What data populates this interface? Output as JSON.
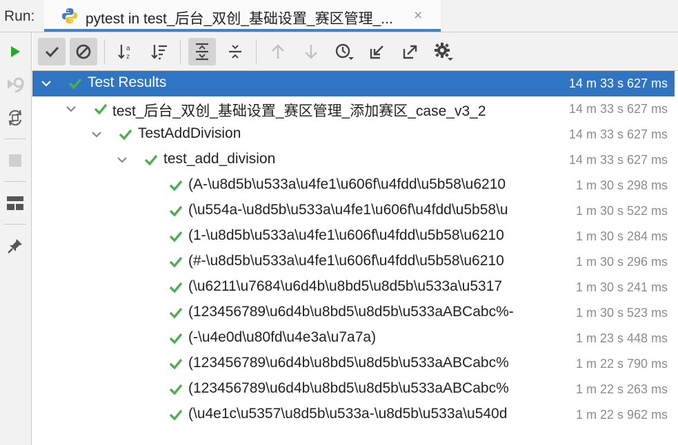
{
  "run_bar": {
    "label": "Run:",
    "tab_title": "pytest in test_后台_双创_基础设置_赛区管理_...",
    "close_glyph": "×"
  },
  "colors": {
    "accent": "#2f75c4",
    "pass_green": "#4caf50",
    "run_green": "#2aa52a"
  },
  "toolbar": {
    "buttons": [
      "show-passed-icon",
      "show-ignored-icon",
      "sort-alpha-icon",
      "sort-duration-icon",
      "expand-all-icon",
      "collapse-all-icon",
      "prev-failed-icon",
      "next-failed-icon",
      "history-icon",
      "import-tests-icon",
      "export-tests-icon",
      "settings-icon"
    ]
  },
  "left_toolbar": {
    "buttons": [
      "rerun-icon",
      "rerun-failed-icon",
      "toggle-auto-test-icon",
      "stop-icon",
      "layout-icon",
      "pin-icon"
    ]
  },
  "tree": {
    "root": {
      "label": "Test Results",
      "time": "14 m 33 s 627 ms"
    },
    "module": {
      "label": "test_后台_双创_基础设置_赛区管理_添加赛区_case_v3_2",
      "time": "14 m 33 s 627 ms"
    },
    "class": {
      "label": "TestAddDivision",
      "time": "14 m 33 s 627 ms"
    },
    "method": {
      "label": "test_add_division",
      "time": "14 m 33 s 627 ms"
    },
    "cases": [
      {
        "label": "(A-\\u8d5b\\u533a\\u4fe1\\u606f\\u4fdd\\u5b58\\u6210",
        "time": "1 m 30 s 298 ms"
      },
      {
        "label": "(\\u554a-\\u8d5b\\u533a\\u4fe1\\u606f\\u4fdd\\u5b58\\u",
        "time": "1 m 30 s 522 ms"
      },
      {
        "label": "(1-\\u8d5b\\u533a\\u4fe1\\u606f\\u4fdd\\u5b58\\u6210",
        "time": "1 m 30 s 284 ms"
      },
      {
        "label": "(#-\\u8d5b\\u533a\\u4fe1\\u606f\\u4fdd\\u5b58\\u6210",
        "time": "1 m 30 s 296 ms"
      },
      {
        "label": "(\\u6211\\u7684\\u6d4b\\u8bd5\\u8d5b\\u533a\\u5317",
        "time": "1 m 30 s 241 ms"
      },
      {
        "label": "(123456789\\u6d4b\\u8bd5\\u8d5b\\u533aABCabc%-",
        "time": "1 m 30 s 523 ms"
      },
      {
        "label": "(-\\u4e0d\\u80fd\\u4e3a\\u7a7a)",
        "time": "1 m 23 s 448 ms"
      },
      {
        "label": "(123456789\\u6d4b\\u8bd5\\u8d5b\\u533aABCabc%",
        "time": "1 m 22 s 790 ms"
      },
      {
        "label": "(123456789\\u6d4b\\u8bd5\\u8d5b\\u533aABCabc%",
        "time": "1 m 22 s 263 ms"
      },
      {
        "label": "(\\u4e1c\\u5357\\u8d5b\\u533a-\\u8d5b\\u533a\\u540d",
        "time": "1 m 22 s 962 ms"
      }
    ]
  }
}
